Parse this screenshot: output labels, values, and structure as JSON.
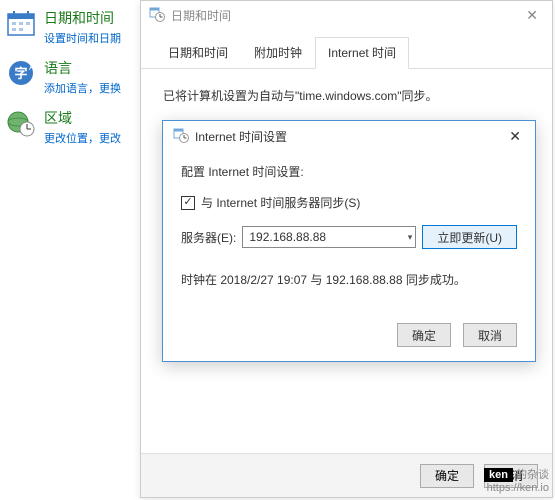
{
  "sidebar": {
    "items": [
      {
        "title": "日期和时间",
        "sub": "设置时间和日期"
      },
      {
        "title": "语言",
        "sub": "添加语言，更换"
      },
      {
        "title": "区域",
        "sub": "更改位置，更改"
      }
    ]
  },
  "win1": {
    "title": "日期和时间",
    "tabs": [
      "日期和时间",
      "附加时钟",
      "Internet 时间"
    ],
    "active_tab": 2,
    "body_text": "已将计算机设置为自动与\"time.windows.com\"同步。",
    "ok": "确定",
    "cancel": "取消"
  },
  "win2": {
    "title": "Internet 时间设置",
    "configure": "配置 Internet 时间设置:",
    "checkbox_label": "与 Internet 时间服务器同步(S)",
    "checkbox_checked": true,
    "server_label": "服务器(E):",
    "server_value": "192.168.88.88",
    "update_now": "立即更新(U)",
    "status": "时钟在 2018/2/27 19:07 与 192.168.88.88 同步成功。",
    "ok": "确定",
    "cancel": "取消"
  },
  "watermark": {
    "badge": "ken",
    "text": " 的杂谈",
    "url": "https://ken.io"
  }
}
